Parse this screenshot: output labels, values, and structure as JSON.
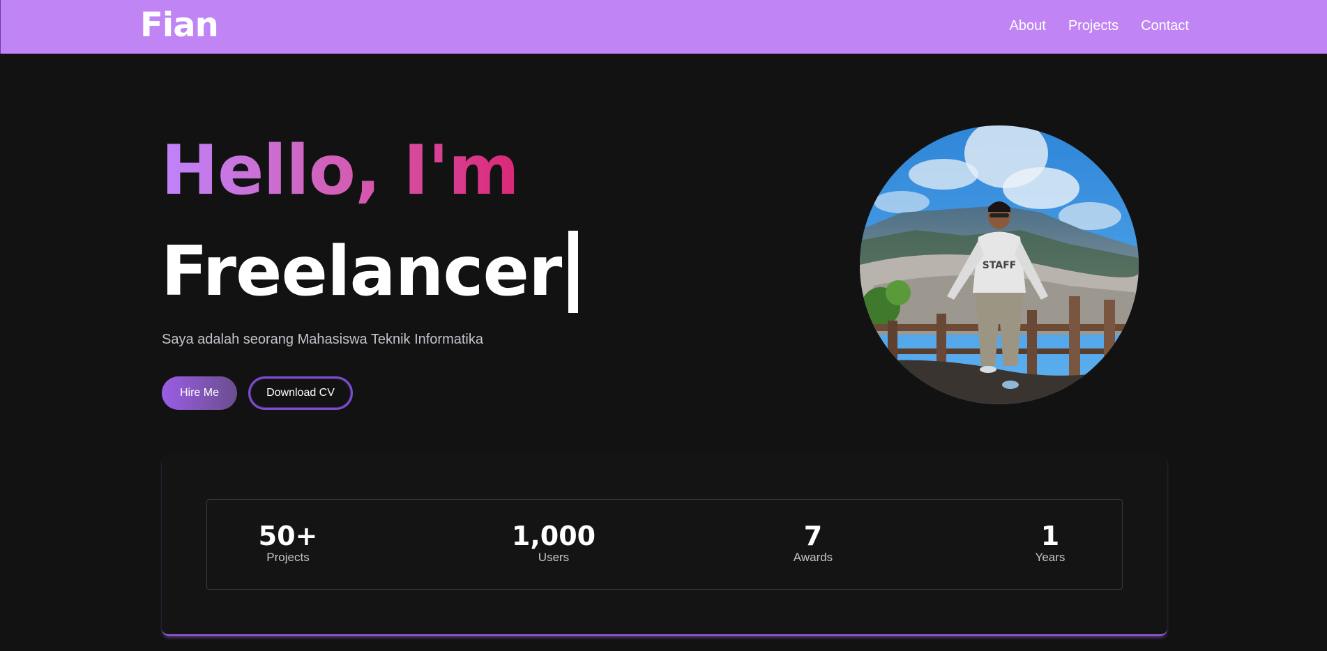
{
  "navbar": {
    "brand": "Fian",
    "links": [
      "About",
      "Projects",
      "Contact"
    ],
    "background": "#c084f5"
  },
  "hero": {
    "greeting": "Hello, I'm",
    "role": "Freelancer",
    "description": "Saya adalah seorang Mahasiswa Teknik Informatika",
    "buttons": {
      "hire": "Hire Me",
      "download": "Download CV"
    },
    "gradient": [
      "#c084fc",
      "#db2777"
    ]
  },
  "stats": [
    {
      "value": "50+",
      "label": "Projects"
    },
    {
      "value": "1,000",
      "label": "Users"
    },
    {
      "value": "7",
      "label": "Awards"
    },
    {
      "value": "1",
      "label": "Years"
    }
  ],
  "colors": {
    "page_bg": "#121212",
    "accent": "#9b5de5"
  }
}
